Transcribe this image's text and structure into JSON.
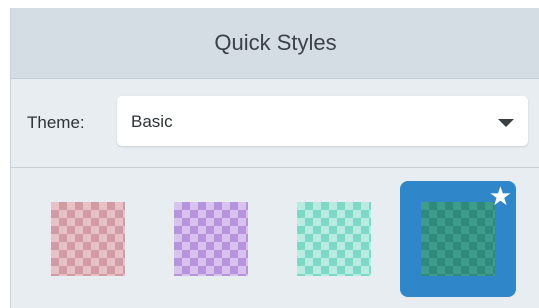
{
  "panel": {
    "title": "Quick Styles"
  },
  "theme": {
    "label": "Theme:",
    "value": "Basic"
  },
  "swatches": [
    {
      "name": "pink",
      "color": "#d29aa3",
      "alt": "#e6c2c7",
      "selected": false
    },
    {
      "name": "purple",
      "color": "#b793dd",
      "alt": "#d8c3ef",
      "selected": false
    },
    {
      "name": "teal",
      "color": "#7fd7c6",
      "alt": "#b9ece1",
      "selected": false
    },
    {
      "name": "green",
      "color": "#2f8a7c",
      "alt": "#3e9c8a",
      "selected": true
    }
  ],
  "colors": {
    "selected_tile": "#2f86c8",
    "header_bg": "#d3dde3",
    "panel_bg": "#e8edf1"
  },
  "icons": {
    "dropdown": "chevron-down-icon",
    "favorite": "star-icon"
  }
}
